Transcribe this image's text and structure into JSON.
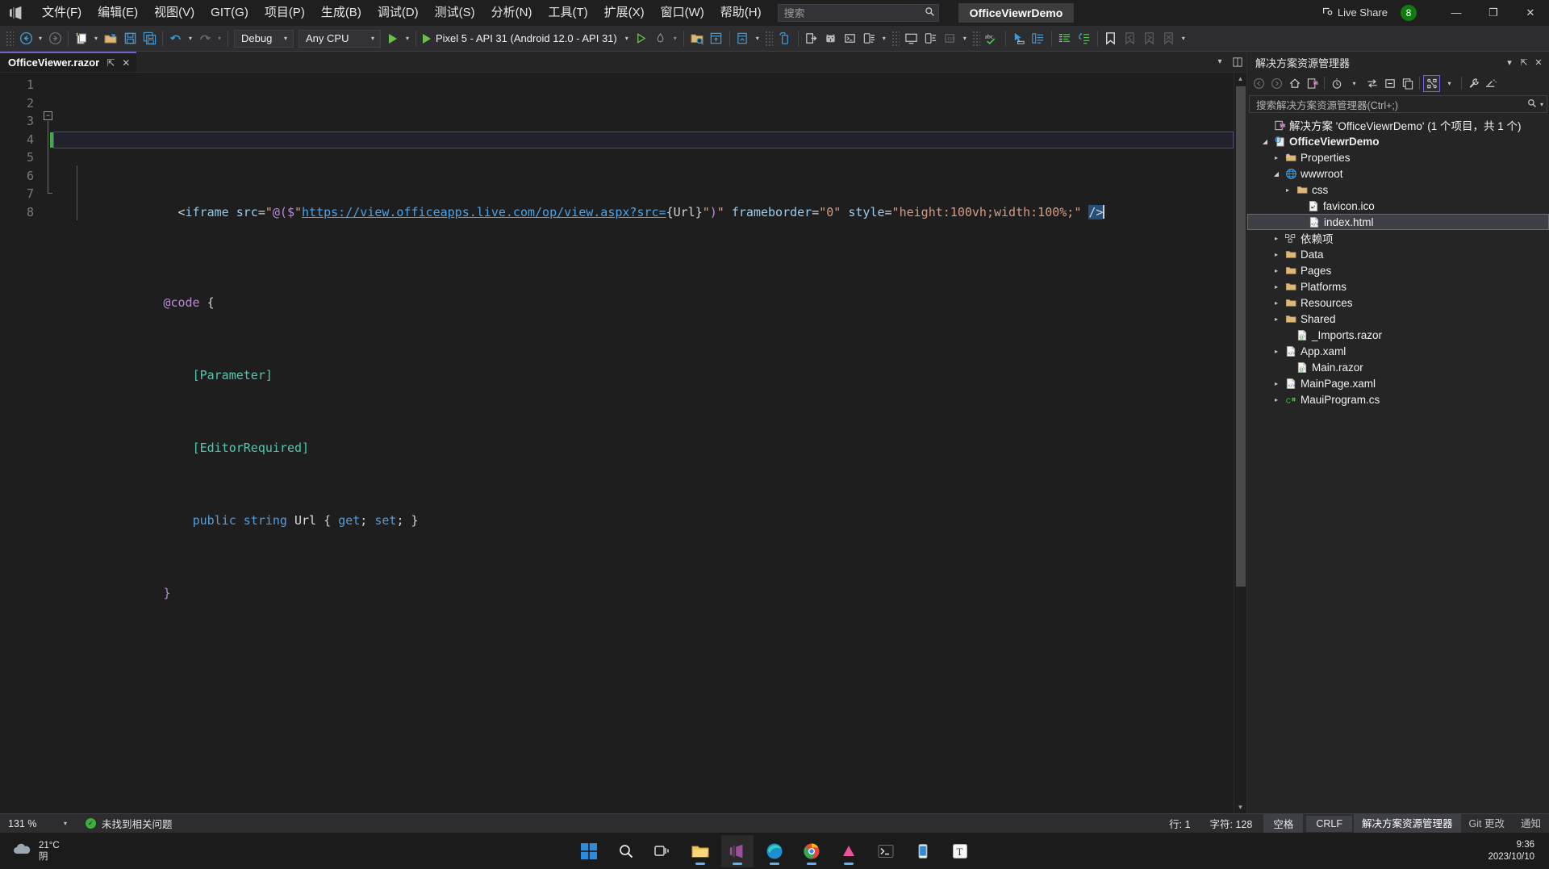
{
  "titlebar": {
    "logo_icon": "visual-studio-logo",
    "menus": [
      {
        "label": "文件(F)"
      },
      {
        "label": "编辑(E)"
      },
      {
        "label": "视图(V)"
      },
      {
        "label": "GIT(G)"
      },
      {
        "label": "项目(P)"
      },
      {
        "label": "生成(B)"
      },
      {
        "label": "调试(D)"
      },
      {
        "label": "测试(S)"
      },
      {
        "label": "分析(N)"
      },
      {
        "label": "工具(T)"
      },
      {
        "label": "扩展(X)"
      },
      {
        "label": "窗口(W)"
      },
      {
        "label": "帮助(H)"
      }
    ],
    "search": {
      "placeholder": "搜索",
      "value": "",
      "icon": "search-icon"
    },
    "title": "OfficeViewrDemo",
    "live_share": "Live Share",
    "notification_count": "8",
    "minimize": "—",
    "maximize": "❐",
    "close": "✕"
  },
  "toolbar": {
    "nav_back_icon": "navigate-back-icon",
    "nav_forward_icon": "navigate-forward-icon",
    "new_item_icon": "new-item-icon",
    "open_file_icon": "open-file-icon",
    "save_icon": "save-icon",
    "save_all_icon": "save-all-icon",
    "undo_icon": "undo-icon",
    "redo_icon": "redo-icon",
    "configuration": "Debug",
    "platform": "Any CPU",
    "run_target": "Pixel 5 - API 31 (Android 12.0 - API 31)",
    "start_icon": "start-debug-icon",
    "start_without_debug_icon": "start-without-debugging-icon",
    "hot_reload_icon": "hot-reload-icon",
    "dropdown_caret": "▾"
  },
  "editor": {
    "tab": {
      "label": "OfficeViewer.razor",
      "pin_icon": "pin-icon",
      "close_icon": "close-icon"
    },
    "line_numbers": [
      "1",
      "2",
      "3",
      "4",
      "5",
      "6",
      "7",
      "8"
    ],
    "code_lines": [
      "<iframe src=\"@($\"https://view.officeapps.live.com/op/view.aspx?src={Url}\")\" frameborder=\"0\" style=\"height:100vh;width:100%;\" />",
      "",
      "@code {",
      "    [Parameter]",
      "    [EditorRequired]",
      "    public string Url { get; set; }",
      "}",
      ""
    ],
    "code_tokens": {
      "l1": {
        "open_angle": "<",
        "tag": "iframe",
        "attr_src": "src",
        "eq": "=",
        "quote": "\"",
        "razor_at_paren": "@($",
        "str_quote": "\"",
        "url": "https://view.officeapps.live.com/op/view.aspx?src=",
        "interp": "{Url}",
        "close_str": "\"",
        "close_paren": ")",
        "attr_frameborder": "frameborder",
        "val_zero": "\"0\"",
        "attr_style": "style",
        "val_style": "\"height:100vh;width:100%;\"",
        "self_close": "/>"
      },
      "l3": {
        "razor": "@code",
        "brace": "{"
      },
      "l4": {
        "attribute": "[Parameter]"
      },
      "l5": {
        "attribute": "[EditorRequired]"
      },
      "l6": {
        "kw_public": "public",
        "kw_string": "string",
        "ident": "Url",
        "open": "{",
        "get": "get",
        "semi1": ";",
        "set": "set",
        "semi2": ";",
        "close": "}"
      },
      "l7": {
        "brace": "}"
      }
    },
    "fold_marker": "−"
  },
  "solution_explorer": {
    "title": "解决方案资源管理器",
    "header_buttons": {
      "dropdown": "▾",
      "pin": "pin-icon",
      "close": "✕"
    },
    "toolbar_icons": [
      "back-icon",
      "forward-icon",
      "home-icon",
      "solution-view-icon",
      "pending-changes-icon",
      "caret-icon",
      "sync-with-active-document-icon",
      "collapse-all-icon",
      "properties-window-icon",
      "show-all-files-icon",
      "caret2-icon",
      "wrench-icon",
      "preview-selected-items-icon"
    ],
    "search": {
      "placeholder": "搜索解决方案资源管理器(Ctrl+;)",
      "value": "",
      "icon": "search-icon",
      "caret": "▾"
    },
    "tree": [
      {
        "label": "解决方案 'OfficeViewrDemo' (1 个项目，共 1 个)",
        "indent": 0,
        "twisty": "",
        "icon": "solution-icon",
        "bold": false,
        "selected": false
      },
      {
        "label": "OfficeViewrDemo",
        "indent": 1,
        "twisty": "▾",
        "icon": "project-web-icon",
        "bold": true,
        "selected": false
      },
      {
        "label": "Properties",
        "indent": 2,
        "twisty": "▸",
        "icon": "properties-folder-icon",
        "bold": false,
        "selected": false
      },
      {
        "label": "wwwroot",
        "indent": 2,
        "twisty": "▾",
        "icon": "wwwroot-globe-icon",
        "bold": false,
        "selected": false
      },
      {
        "label": "css",
        "indent": 3,
        "twisty": "▸",
        "icon": "folder-icon",
        "bold": false,
        "selected": false
      },
      {
        "label": "favicon.ico",
        "indent": 4,
        "twisty": "",
        "icon": "image-file-icon",
        "bold": false,
        "selected": false
      },
      {
        "label": "index.html",
        "indent": 4,
        "twisty": "",
        "icon": "html-file-icon",
        "bold": false,
        "selected": true
      },
      {
        "label": "依赖项",
        "indent": 2,
        "twisty": "▸",
        "icon": "dependencies-icon",
        "bold": false,
        "selected": false
      },
      {
        "label": "Data",
        "indent": 2,
        "twisty": "▸",
        "icon": "folder-icon",
        "bold": false,
        "selected": false
      },
      {
        "label": "Pages",
        "indent": 2,
        "twisty": "▸",
        "icon": "folder-icon",
        "bold": false,
        "selected": false
      },
      {
        "label": "Platforms",
        "indent": 2,
        "twisty": "▸",
        "icon": "folder-icon",
        "bold": false,
        "selected": false
      },
      {
        "label": "Resources",
        "indent": 2,
        "twisty": "▸",
        "icon": "folder-icon",
        "bold": false,
        "selected": false
      },
      {
        "label": "Shared",
        "indent": 2,
        "twisty": "▸",
        "icon": "folder-icon",
        "bold": false,
        "selected": false
      },
      {
        "label": "_Imports.razor",
        "indent": 3,
        "twisty": "",
        "icon": "razor-file-icon",
        "bold": false,
        "selected": false
      },
      {
        "label": "App.xaml",
        "indent": 2,
        "twisty": "▸",
        "icon": "xaml-file-icon",
        "bold": false,
        "selected": false
      },
      {
        "label": "Main.razor",
        "indent": 3,
        "twisty": "",
        "icon": "razor-file-icon",
        "bold": false,
        "selected": false
      },
      {
        "label": "MainPage.xaml",
        "indent": 2,
        "twisty": "▸",
        "icon": "xaml-file-icon",
        "bold": false,
        "selected": false
      },
      {
        "label": "MauiProgram.cs",
        "indent": 2,
        "twisty": "▸",
        "icon": "csharp-file-icon",
        "bold": false,
        "selected": false
      }
    ]
  },
  "statusbar": {
    "zoom": "131 %",
    "zoom_caret": "▾",
    "diagnostics": "未找到相关问题",
    "diagnostics_icon": "check-circle-icon",
    "line": "行: 1",
    "column": "字符: 128",
    "indent": "空格",
    "eol": "CRLF",
    "tabs": [
      {
        "label": "解决方案资源管理器",
        "active": true
      },
      {
        "label": "Git 更改",
        "active": false
      },
      {
        "label": "通知",
        "active": false
      }
    ]
  },
  "taskbar": {
    "weather_temp": "21°C",
    "weather_desc": "阴",
    "weather_icon": "cloud-icon",
    "items": [
      {
        "name": "start-button",
        "icon": "windows-logo",
        "running": false
      },
      {
        "name": "search-taskbar",
        "icon": "search-icon",
        "running": false
      },
      {
        "name": "task-view",
        "icon": "task-view-icon",
        "running": false
      },
      {
        "name": "file-explorer",
        "icon": "folder-icon",
        "running": true
      },
      {
        "name": "visual-studio",
        "icon": "visual-studio-icon",
        "running": true,
        "active": true
      },
      {
        "name": "edge-browser",
        "icon": "edge-icon",
        "running": true
      },
      {
        "name": "chrome-browser",
        "icon": "chrome-icon",
        "running": true
      },
      {
        "name": "app-pink",
        "icon": "pink-app-icon",
        "running": true
      },
      {
        "name": "terminal",
        "icon": "terminal-icon",
        "running": false
      },
      {
        "name": "phone-link",
        "icon": "phone-icon",
        "running": false
      },
      {
        "name": "typora",
        "icon": "typora-icon",
        "running": false
      }
    ],
    "clock_time": "9:36",
    "clock_date": "2023/10/10"
  }
}
